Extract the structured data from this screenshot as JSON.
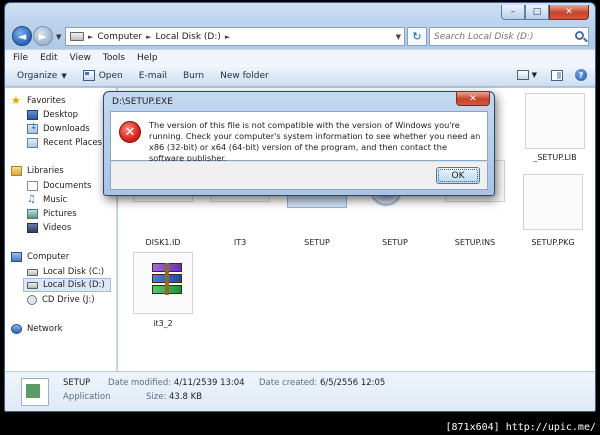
{
  "window": {
    "caption_minimize": "–",
    "caption_maximize": "□",
    "caption_close": "✕"
  },
  "nav": {
    "back_glyph": "◄",
    "forward_glyph": "►",
    "breadcrumbs": [
      "Computer",
      "Local Disk (D:)"
    ],
    "search_placeholder": "Search Local Disk (D:)"
  },
  "menu": [
    "File",
    "Edit",
    "View",
    "Tools",
    "Help"
  ],
  "commands": {
    "organize": "Organize",
    "open": "Open",
    "email": "E-mail",
    "burn": "Burn",
    "new_folder": "New folder"
  },
  "sidebar": {
    "favorites": "Favorites",
    "desktop": "Desktop",
    "downloads": "Downloads",
    "recent_places": "Recent Places",
    "libraries": "Libraries",
    "documents": "Documents",
    "music": "Music",
    "pictures": "Pictures",
    "videos": "Videos",
    "computer": "Computer",
    "local_disk_c": "Local Disk (C:)",
    "local_disk_d": "Local Disk (D:)",
    "cd_drive": "CD Drive (J:)",
    "network": "Network"
  },
  "files": {
    "setup_lib": "_SETUP.LIB",
    "disk1_id": "DISK1.ID",
    "it3": "IT3",
    "setup_image": "SETUP",
    "setup_exe": "SETUP",
    "setup_ins": "SETUP.INS",
    "setup_pkg": "SETUP.PKG",
    "it3_2": "it3_2"
  },
  "details": {
    "name": "SETUP",
    "type": "Application",
    "modified_label": "Date modified:",
    "modified_value": "4/11/2539 13:04",
    "size_label": "Size:",
    "size_value": "43.8 KB",
    "created_label": "Date created:",
    "created_value": "6/5/2556 12:05"
  },
  "dialog": {
    "title": "D:\\SETUP.EXE",
    "message": "The version of this file is not compatible with the version of Windows you're running. Check your computer's system information to see whether you need an x86 (32-bit) or x64 (64-bit) version of the program, and then contact the software publisher.",
    "ok_label": "OK",
    "close_glyph": "✕"
  },
  "watermark": "[871x604] http://upic.me/"
}
